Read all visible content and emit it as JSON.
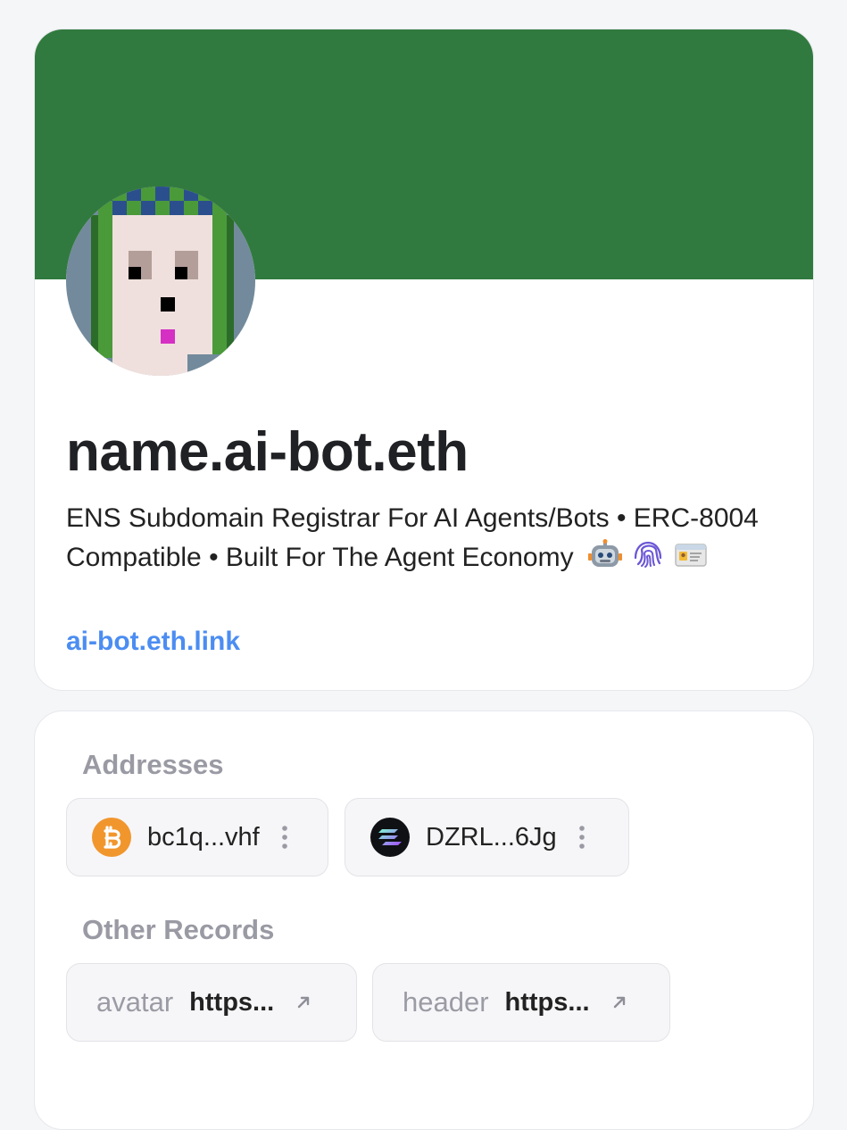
{
  "profile": {
    "name": "name.ai-bot.eth",
    "bio": "ENS Subdomain Registrar For AI Agents/Bots • ERC-8004 Compatible • Built For The Agent Economy",
    "bio_emojis": [
      "robot-face-icon",
      "fingerprint-icon",
      "id-card-icon"
    ],
    "link": "ai-bot.eth.link",
    "banner_color": "#317a3f",
    "link_color": "#4b8df2"
  },
  "records": {
    "addresses_title": "Addresses",
    "addresses": [
      {
        "coin": "bitcoin-icon",
        "value": "bc1q...vhf",
        "icon_color": "#f1962d"
      },
      {
        "coin": "solana-icon",
        "value": "DZRL...6Jg",
        "icon_color": "#0f1115"
      }
    ],
    "other_title": "Other Records",
    "other": [
      {
        "key": "avatar",
        "value": "https...",
        "icon": "external-link-icon"
      },
      {
        "key": "header",
        "value": "https...",
        "icon": "external-link-icon"
      }
    ]
  },
  "colors": {
    "page_background": "#f5f6f8",
    "card_background": "#ffffff",
    "pill_background": "#f6f6f8",
    "muted_text": "#9a9aa4"
  }
}
